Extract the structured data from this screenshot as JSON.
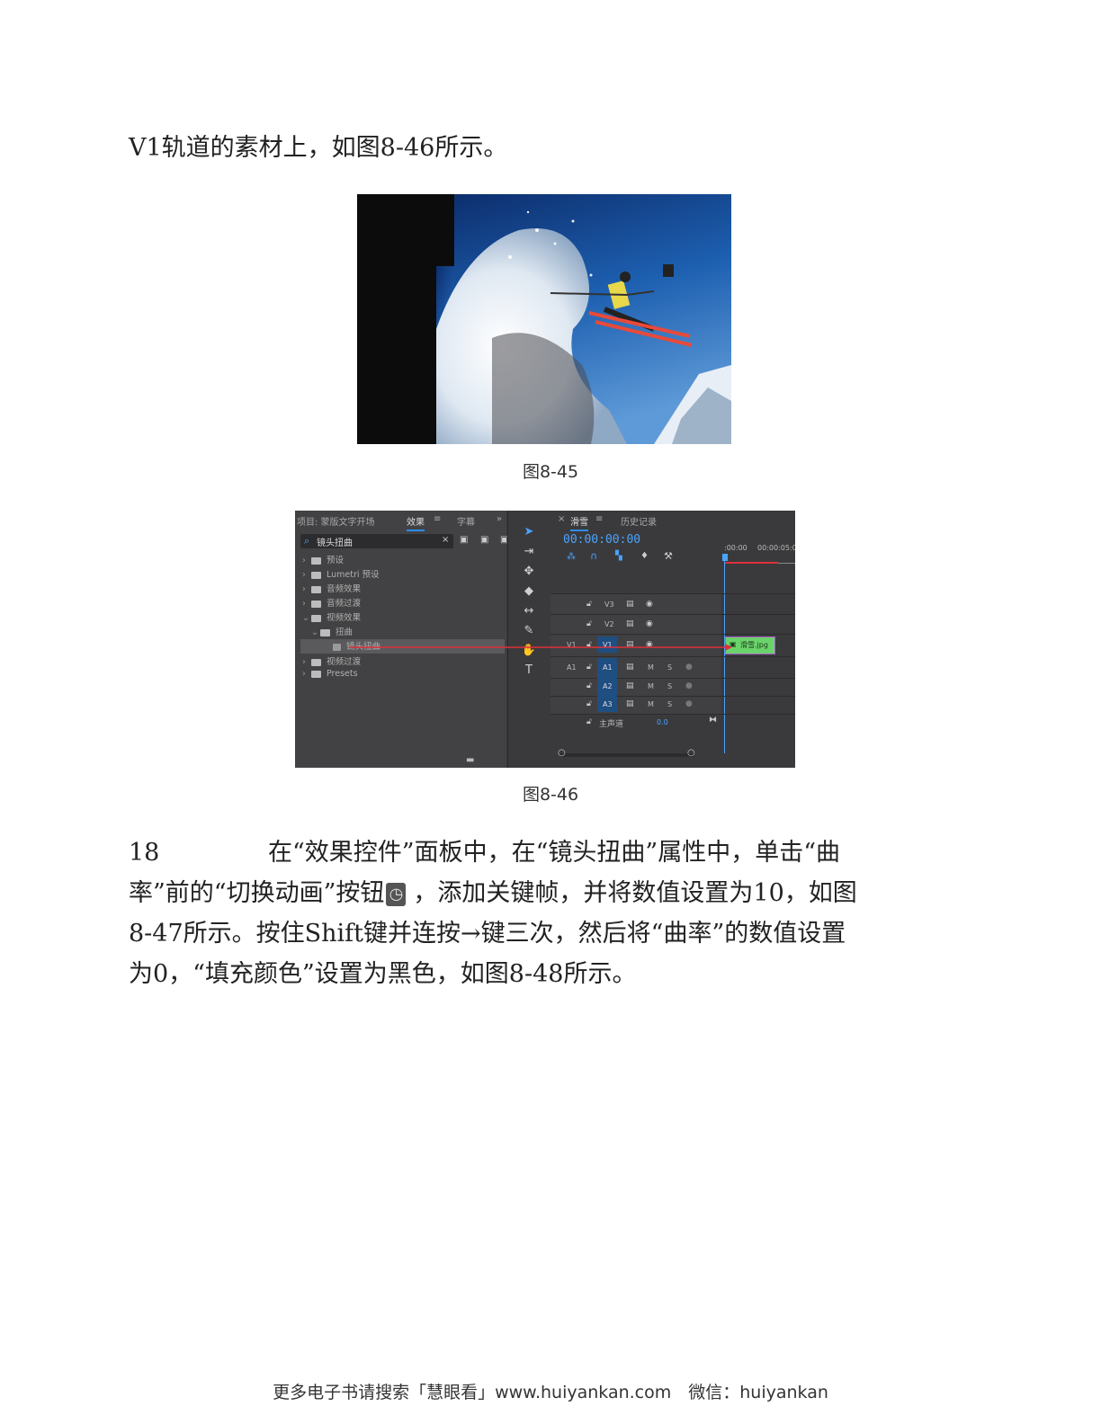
{
  "text": {
    "intro": "V1轨道的素材上，如图8-46所示。",
    "step_number": "18",
    "step_body_1": "在“效果控件”面板中，在“镜头扭曲”属性中，单击“曲",
    "step_body_2a": "率”前的“切换动画”按钮",
    "step_body_2b": "，添加关键帧，并将数值设置为10，如图",
    "step_body_3": "8-47所示。按住Shift键并连按→键三次，然后将“曲率”的数值设置",
    "step_body_4": "为0，“填充颜色”设置为黑色，如图8-48所示。"
  },
  "figures": {
    "fig45_caption": "图8-45",
    "fig46_caption": "图8-46"
  },
  "premiere": {
    "left_tabs": {
      "project": "项目: 蒙版文字开场",
      "effects": "效果",
      "captions": "字幕",
      "more": "»"
    },
    "search_value": "镜头扭曲",
    "tree": [
      "预设",
      "Lumetri 预设",
      "音频效果",
      "音频过渡",
      "视频效果",
      "扭曲",
      "镜头扭曲",
      "视频过渡",
      "Presets"
    ],
    "timeline_tabs": {
      "sequence": "滑雪",
      "history": "历史记录"
    },
    "timecode": "00:00:00:00",
    "ruler": [
      ":00:00",
      "00:00:05:0"
    ],
    "tracks": {
      "v3": "V3",
      "v2": "V2",
      "v1": "V1",
      "a1": "A1",
      "a2": "A2",
      "a3": "A3",
      "src_v1": "V1",
      "src_a1": "A1",
      "master": "主声道",
      "master_value": "0.0",
      "m": "M",
      "s": "S"
    },
    "clip_label": "滑雪.jpg"
  },
  "footer": "更多电子书请搜索「慧眼看」www.huiyankan.com　微信：huiyankan",
  "colors": {
    "accent": "#2d8ceb",
    "timecode": "#4aa3ff",
    "clip": "#6bd36b",
    "arrow": "#e0303a"
  }
}
